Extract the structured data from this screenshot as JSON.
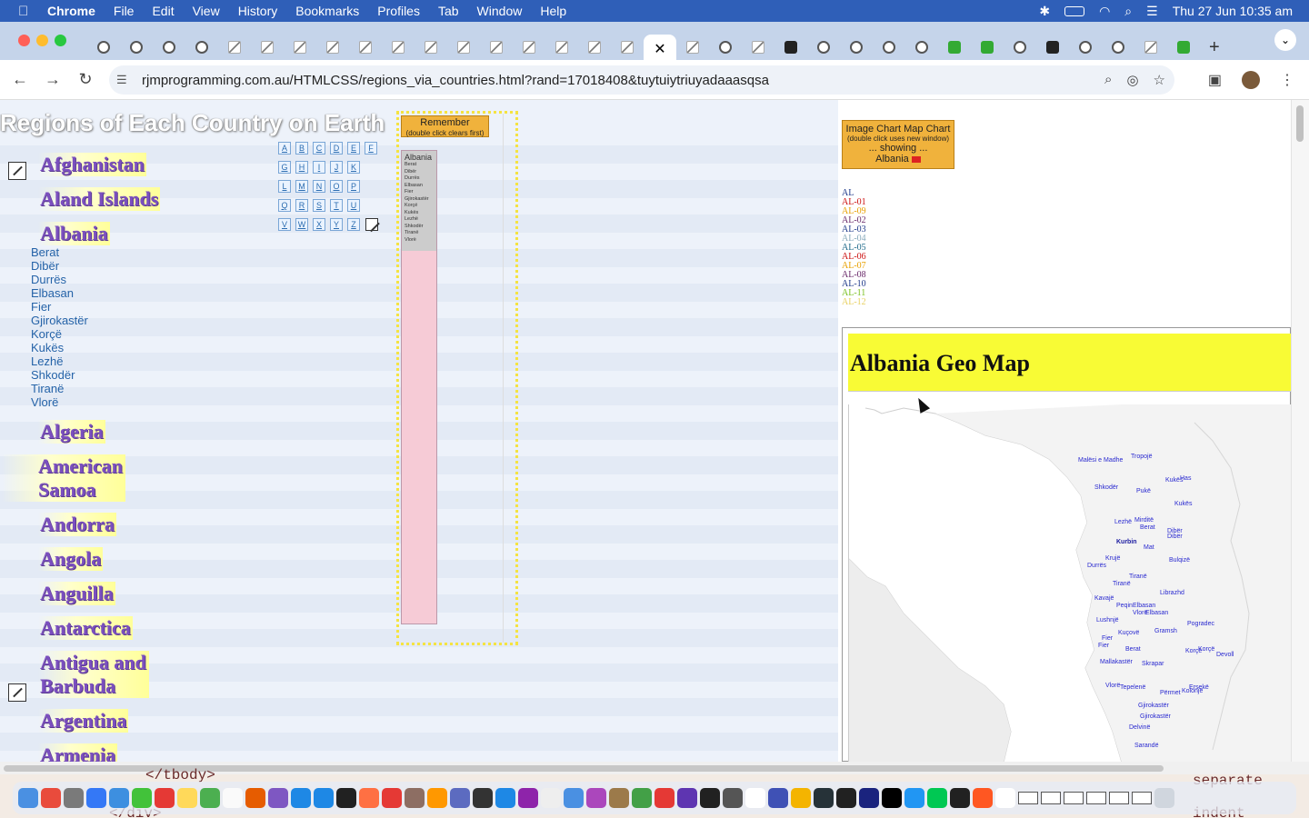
{
  "menubar": {
    "app": "Chrome",
    "items": [
      "File",
      "Edit",
      "View",
      "History",
      "Bookmarks",
      "Profiles",
      "Tab",
      "Window",
      "Help"
    ],
    "clock": "Thu 27 Jun  10:35 am"
  },
  "browser": {
    "url": "rjmprogramming.com.au/HTMLCSS/regions_via_countries.html?rand=17018408&tuytuiytriuyadaaasqsa",
    "tab_close": "✕",
    "new_tab": "+"
  },
  "page": {
    "title": "Regions of Each Country on Earth",
    "countries": [
      "Afghanistan",
      "Aland Islands",
      "Albania",
      "Algeria",
      "American Samoa",
      "Andorra",
      "Angola",
      "Anguilla",
      "Antarctica",
      "Antigua and Barbuda",
      "Argentina",
      "Armenia"
    ],
    "albania_regions": [
      "Berat",
      "Dibër",
      "Durrës",
      "Elbasan",
      "Fier",
      "Gjirokastër",
      "Korçë",
      "Kukës",
      "Lezhë",
      "Shkodër",
      "Tiranë",
      "Vlorë"
    ],
    "alphabet_rows": [
      [
        "A",
        "B",
        "C",
        "D",
        "E",
        "F"
      ],
      [
        "G",
        "H",
        "I",
        "J",
        "K"
      ],
      [
        "L",
        "M",
        "N",
        "O",
        "P"
      ],
      [
        "Q",
        "R",
        "S",
        "T",
        "U"
      ],
      [
        "V",
        "W",
        "X",
        "Y",
        "Z"
      ]
    ],
    "remember": {
      "label": "Remember",
      "sub": "(double click clears first)",
      "list_head": "Albania"
    },
    "chart_button": {
      "label": "Image Chart Map Chart",
      "sub": "(double click uses new window)",
      "showing": "... showing ...",
      "country": "Albania"
    },
    "codes": [
      {
        "code": "AL",
        "color": "#1f3a8a"
      },
      {
        "code": "AL-01",
        "color": "#cc1111"
      },
      {
        "code": "AL-09",
        "color": "#e8a000"
      },
      {
        "code": "AL-02",
        "color": "#6a2a6a"
      },
      {
        "code": "AL-03",
        "color": "#1f3a8a"
      },
      {
        "code": "AL-04",
        "color": "#88aabb"
      },
      {
        "code": "AL-05",
        "color": "#1f6a8a"
      },
      {
        "code": "AL-06",
        "color": "#cc1111"
      },
      {
        "code": "AL-07",
        "color": "#e8a000"
      },
      {
        "code": "AL-08",
        "color": "#6a2a6a"
      },
      {
        "code": "AL-10",
        "color": "#1f3a8a"
      },
      {
        "code": "AL-11",
        "color": "#7ac020"
      },
      {
        "code": "AL-12",
        "color": "#e8d060"
      }
    ],
    "geo_title": "Albania Geo Map",
    "map_labels": [
      "Malësi e Madhe",
      "Tropojë",
      "Shkodër",
      "Pukë",
      "Kukës",
      "Has",
      "Kukës",
      "Lezhë",
      "Mirditë",
      "Berat",
      "Dibër",
      "Dibër",
      "Kurbin",
      "Mat",
      "Krujë",
      "Durrës",
      "Bulqizë",
      "Tiranë",
      "Tiranë",
      "Librazhd",
      "Kavajë",
      "Peqin",
      "Elbasan",
      "Vlorë",
      "Elbasan",
      "Lushnjë",
      "Pogradec",
      "Kuçovë",
      "Gramsh",
      "Fier",
      "Fier",
      "Berat",
      "Korçë",
      "Korçë",
      "Devoll",
      "Mallakastër",
      "Skrapar",
      "Vlorë",
      "Tepelenë",
      "Përmet",
      "Ersekë",
      "Kolonjë",
      "Gjirokastër",
      "Gjirokastër",
      "Delvinë",
      "Sarandë"
    ]
  },
  "peek": {
    "left": "</tbody>",
    "left2": "</div>",
    "right": "separate",
    "right2": "indent"
  }
}
